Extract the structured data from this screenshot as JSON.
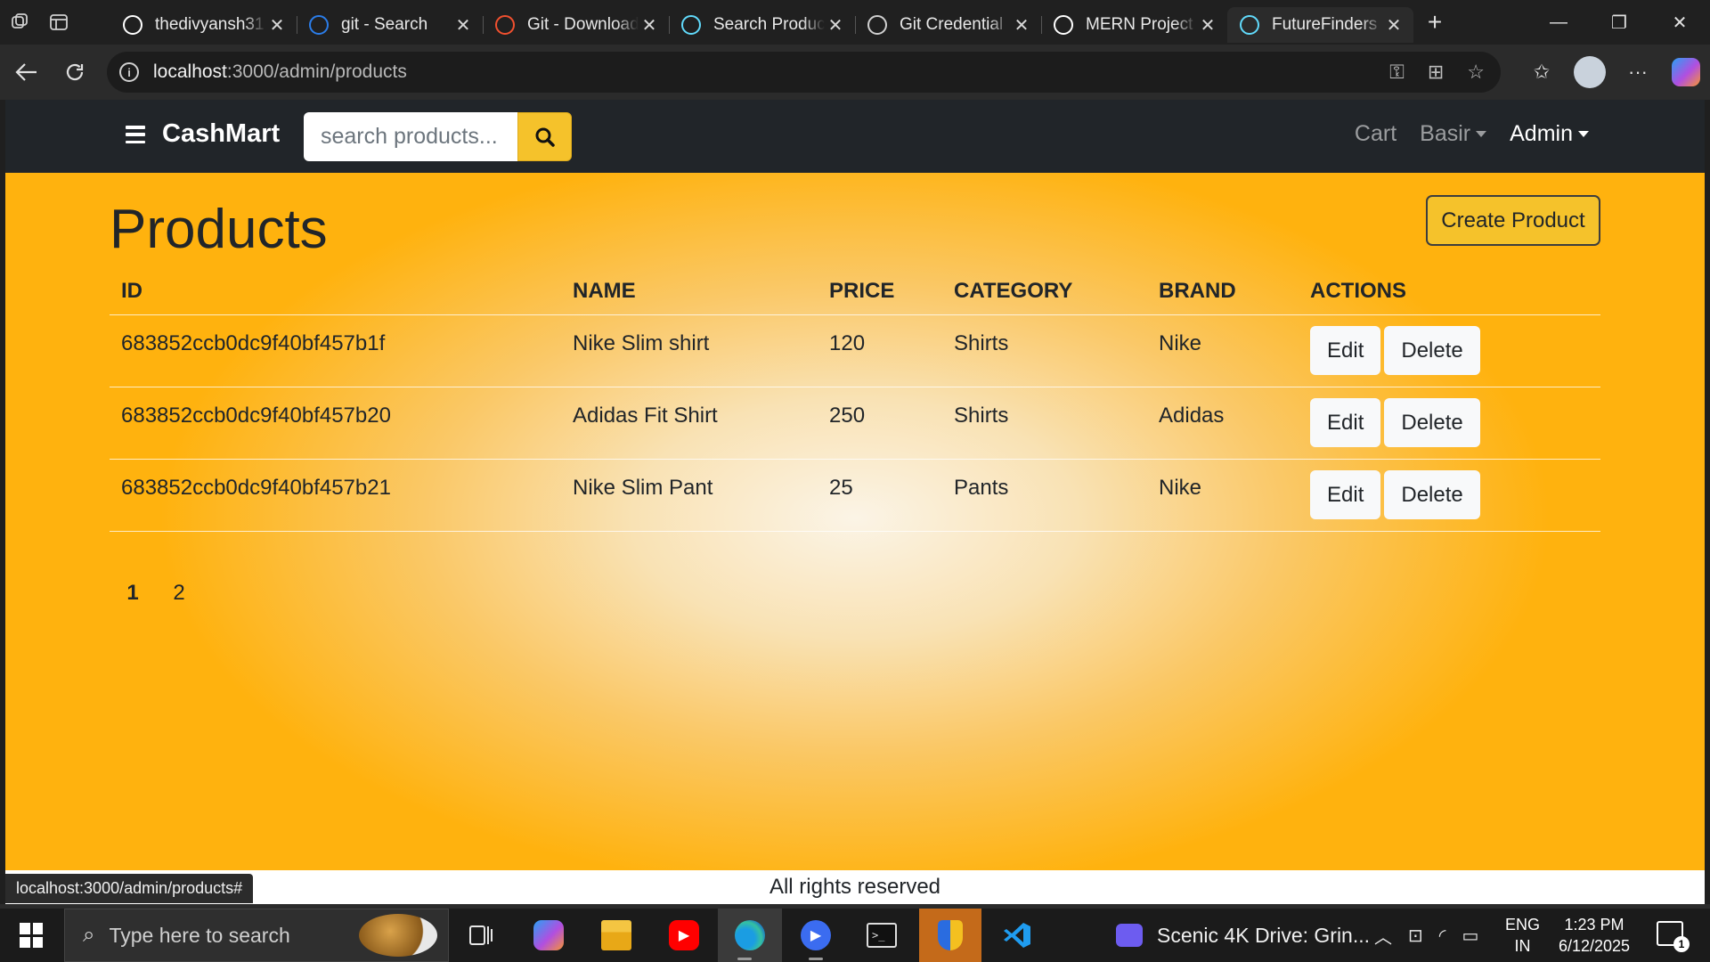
{
  "browser": {
    "tabs": [
      {
        "label": "thedivyansh31",
        "favicon": "github-icon",
        "favicon_color": "#ffffff"
      },
      {
        "label": "git - Search",
        "favicon": "search-icon",
        "favicon_color": "#2b7de9"
      },
      {
        "label": "Git - Download",
        "favicon": "git-icon",
        "favicon_color": "#f1502f"
      },
      {
        "label": "Search Product",
        "favicon": "react-icon",
        "favicon_color": "#61dafb"
      },
      {
        "label": "Git Credential",
        "favicon": "globe-icon",
        "favicon_color": "#d0d0d0"
      },
      {
        "label": "MERN Project",
        "favicon": "chatgpt-icon",
        "favicon_color": "#ffffff"
      },
      {
        "label": "FutureFinders",
        "favicon": "react-icon",
        "favicon_color": "#61dafb",
        "active": true
      }
    ],
    "url_host": "localhost",
    "url_path": ":3000/admin/products",
    "status_url": "localhost:3000/admin/products#"
  },
  "site": {
    "brand": "CashMart",
    "search_placeholder": "search products...",
    "nav": {
      "cart": "Cart",
      "user": "Basir",
      "admin": "Admin"
    },
    "accent_color": "#f5c22b",
    "navbar_color": "#212529"
  },
  "page": {
    "title": "Products",
    "create_button": "Create Product",
    "columns": [
      "ID",
      "NAME",
      "PRICE",
      "CATEGORY",
      "BRAND",
      "ACTIONS"
    ],
    "rows": [
      {
        "id": "683852ccb0dc9f40bf457b1f",
        "name": "Nike Slim shirt",
        "price": "120",
        "category": "Shirts",
        "brand": "Nike"
      },
      {
        "id": "683852ccb0dc9f40bf457b20",
        "name": "Adidas Fit Shirt",
        "price": "250",
        "category": "Shirts",
        "brand": "Adidas"
      },
      {
        "id": "683852ccb0dc9f40bf457b21",
        "name": "Nike Slim Pant",
        "price": "25",
        "category": "Pants",
        "brand": "Nike"
      }
    ],
    "edit_label": "Edit",
    "delete_label": "Delete",
    "pages": [
      "1",
      "2"
    ],
    "current_page": "1",
    "footer": "All rights reserved"
  },
  "taskbar": {
    "search_placeholder": "Type here to search",
    "media_title": "Scenic 4K Drive: Grin...",
    "lang_top": "ENG",
    "lang_bottom": "IN",
    "time": "1:23 PM",
    "date": "6/12/2025",
    "notification_count": "1"
  }
}
